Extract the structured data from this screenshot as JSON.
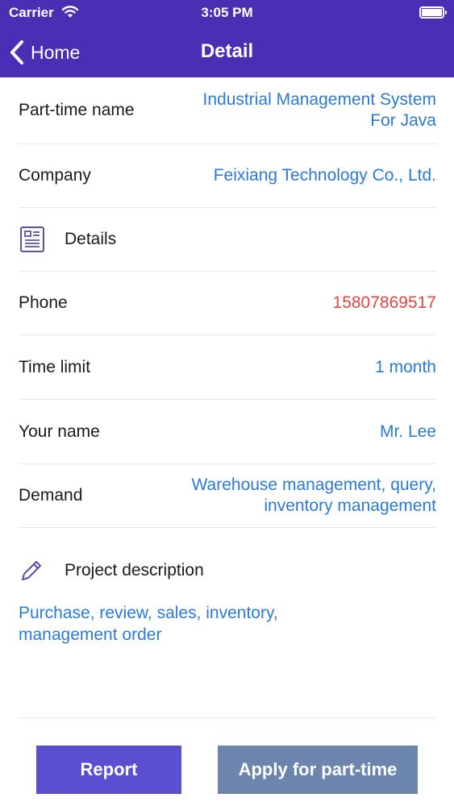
{
  "status_bar": {
    "carrier": "Carrier",
    "time": "3:05 PM"
  },
  "nav": {
    "back_label": "Home",
    "title": "Detail"
  },
  "fields": {
    "part_time_name": {
      "label": "Part-time name",
      "value_line1": "Industrial Management System",
      "value_line2": "For Java"
    },
    "company": {
      "label": "Company",
      "value": "Feixiang Technology Co., Ltd."
    },
    "details": {
      "label": "Details",
      "icon": "document-list-icon"
    },
    "phone": {
      "label": "Phone",
      "value": "15807869517",
      "color": "#e0463c"
    },
    "time_limit": {
      "label": "Time limit",
      "value": "1 month"
    },
    "your_name": {
      "label": "Your name",
      "value": "Mr. Lee"
    },
    "demand": {
      "label": "Demand",
      "value_line1": "Warehouse management, query,",
      "value_line2": "inventory management"
    }
  },
  "project_description": {
    "label": "Project description",
    "icon": "pencil-icon",
    "text_line1": "Purchase, review, sales, inventory,",
    "text_line2": "management order"
  },
  "buttons": {
    "report": "Report",
    "apply": "Apply for part-time"
  },
  "colors": {
    "header_bg": "#4a2fb4",
    "value_text": "#2a7ad6",
    "report_button": "#5a4fd1",
    "apply_button": "#6b85ad"
  }
}
